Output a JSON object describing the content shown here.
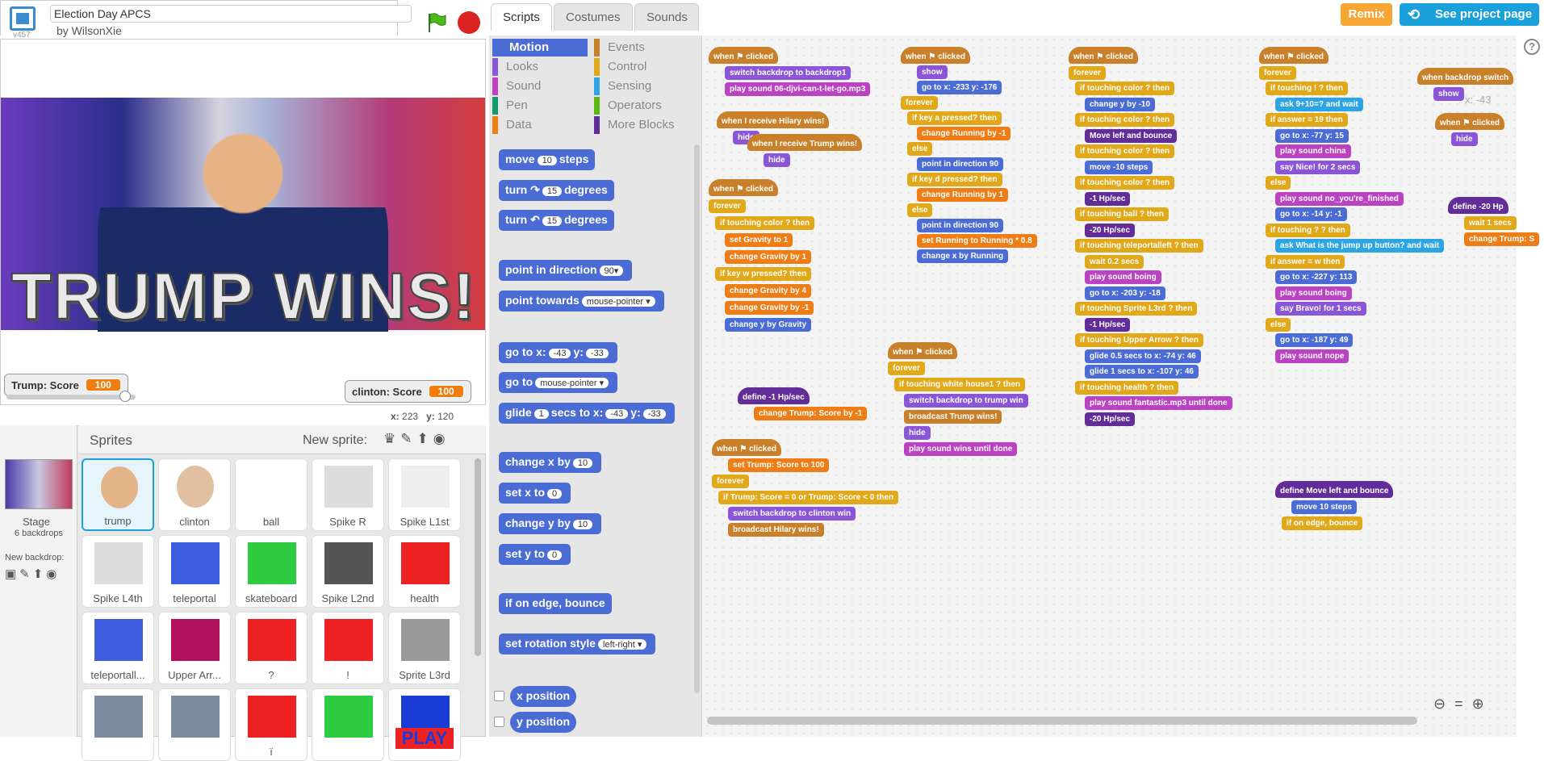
{
  "project": {
    "title": "Election Day APCS",
    "author": "by WilsonXie",
    "version": "v457"
  },
  "stage": {
    "banner_text": "TRUMP WINS!",
    "monitors": [
      {
        "label": "Trump: Score",
        "value": "100"
      },
      {
        "label": "clinton: Score",
        "value": "100"
      }
    ],
    "mouse_x_label": "x:",
    "mouse_x": "223",
    "mouse_y_label": "y:",
    "mouse_y": "120"
  },
  "sprites_panel": {
    "title": "Sprites",
    "new_sprite_label": "New sprite:",
    "stage_label": "Stage",
    "stage_backdrops": "6 backdrops",
    "new_backdrop_label": "New backdrop:",
    "sprites": [
      {
        "name": "trump",
        "selected": true
      },
      {
        "name": "clinton"
      },
      {
        "name": "ball"
      },
      {
        "name": "Spike R"
      },
      {
        "name": "Spike L1st"
      },
      {
        "name": "Spike L4th"
      },
      {
        "name": "teleportal"
      },
      {
        "name": "skateboard"
      },
      {
        "name": "Spike L2nd"
      },
      {
        "name": "health"
      },
      {
        "name": "teleportall..."
      },
      {
        "name": "Upper Arr..."
      },
      {
        "name": "?"
      },
      {
        "name": "!"
      },
      {
        "name": "Sprite L3rd"
      },
      {
        "name": ""
      },
      {
        "name": ""
      },
      {
        "name": "ï"
      },
      {
        "name": ""
      },
      {
        "name": "PLAY"
      }
    ]
  },
  "tabs": [
    "Scripts",
    "Costumes",
    "Sounds"
  ],
  "header_buttons": {
    "remix": "Remix",
    "see_project": "See project page"
  },
  "categories": [
    {
      "name": "Motion",
      "color": "#4a6cd4",
      "active": true
    },
    {
      "name": "Events",
      "color": "#c8802a"
    },
    {
      "name": "Looks",
      "color": "#8a55d7"
    },
    {
      "name": "Control",
      "color": "#e1a91a"
    },
    {
      "name": "Sound",
      "color": "#bb42c3"
    },
    {
      "name": "Sensing",
      "color": "#2ca5e2"
    },
    {
      "name": "Pen",
      "color": "#0e9a6c"
    },
    {
      "name": "Operators",
      "color": "#5cb712"
    },
    {
      "name": "Data",
      "color": "#ee7d16"
    },
    {
      "name": "More Blocks",
      "color": "#632d99"
    }
  ],
  "palette_blocks": [
    {
      "text": "move",
      "arg": "10",
      "suffix": "steps"
    },
    {
      "text": "turn ↷",
      "arg": "15",
      "suffix": "degrees"
    },
    {
      "text": "turn ↶",
      "arg": "15",
      "suffix": "degrees"
    },
    {
      "text": "point in direction",
      "arg": "90▾",
      "suffix": ""
    },
    {
      "text": "point towards",
      "arg": "mouse-pointer ▾",
      "suffix": ""
    },
    {
      "text": "go to x:",
      "arg": "-43",
      "suffix": "y:",
      "arg2": "-33"
    },
    {
      "text": "go to",
      "arg": "mouse-pointer ▾",
      "suffix": ""
    },
    {
      "text": "glide",
      "arg": "1",
      "suffix": "secs to x:",
      "arg2": "-43",
      "suffix2": "y:",
      "arg3": "-33"
    },
    {
      "text": "change x by",
      "arg": "10",
      "suffix": ""
    },
    {
      "text": "set x to",
      "arg": "0",
      "suffix": ""
    },
    {
      "text": "change y by",
      "arg": "10",
      "suffix": ""
    },
    {
      "text": "set y to",
      "arg": "0",
      "suffix": ""
    },
    {
      "text": "if on edge, bounce",
      "arg": "",
      "suffix": ""
    },
    {
      "text": "set rotation style",
      "arg": "left-right ▾",
      "suffix": ""
    },
    {
      "text": "x position",
      "arg": "",
      "suffix": ""
    },
    {
      "text": "y position",
      "arg": "",
      "suffix": ""
    }
  ],
  "scripts": {
    "s1": [
      "when ⚑ clicked",
      "switch backdrop to backdrop1",
      "play sound 06-djvi-can-t-let-go.mp3"
    ],
    "s2": [
      "when I receive Hilary wins!",
      "hide"
    ],
    "s3": [
      "when I receive Trump wins!",
      "hide"
    ],
    "s4": [
      "when ⚑ clicked",
      "forever",
      "if touching color ? then",
      "set Gravity to 1",
      "change Gravity by 1",
      "if key w pressed? then",
      "change Gravity by 4",
      "change Gravity by -1",
      "change y by Gravity"
    ],
    "s5": [
      "define -1 Hp/sec",
      "change Trump: Score by -1"
    ],
    "s6": [
      "when ⚑ clicked",
      "set Trump: Score to 100",
      "forever",
      "if Trump: Score = 0 or Trump: Score < 0 then",
      "switch backdrop to clinton win",
      "broadcast Hilary wins!"
    ],
    "s7": [
      "when ⚑ clicked",
      "show",
      "go to x: -233 y: -176",
      "forever",
      "if key a pressed? then",
      "change Running by -1",
      "else",
      "point in direction 90",
      "if key d pressed? then",
      "change Running by 1",
      "else",
      "point in direction 90",
      "set Running to Running * 0.8",
      "change x by Running"
    ],
    "s8": [
      "when ⚑ clicked",
      "forever",
      "if touching white house1 ? then",
      "switch backdrop to trump win",
      "broadcast Trump wins!",
      "hide",
      "play sound wins until done"
    ],
    "s9": [
      "when ⚑ clicked",
      "forever",
      "if touching color ? then",
      "change y by -10",
      "if touching color ? then",
      "Move left and bounce",
      "if touching color ? then",
      "move -10 steps",
      "if touching color ? then",
      "-1 Hp/sec",
      "if touching ball ? then",
      "-20 Hp/sec",
      "if touching teleportalleft ? then",
      "wait 0.2 secs",
      "play sound boing",
      "go to x: -203 y: -18",
      "if touching Sprite L3rd ? then",
      "-1 Hp/sec",
      "if touching Upper Arrow ? then",
      "glide 0.5 secs to x: -74 y: 46",
      "glide 1 secs to x: -107 y: 46",
      "if touching health ? then",
      "play sound fantastic.mp3 until done",
      "-20 Hp/sec"
    ],
    "s10": [
      "when ⚑ clicked",
      "forever",
      "if touching ! ? then",
      "ask 9+10=? and wait",
      "if answer = 19 then",
      "go to x: -77 y: 15",
      "play sound china",
      "say Nice! for 2 secs",
      "else",
      "play sound no_you're_finished",
      "go to x: -14 y: -1",
      "if touching ? ? then",
      "ask What is the jump up button? and wait",
      "if answer = w then",
      "go to x: -227 y: 113",
      "play sound boing",
      "say Bravo! for 1 secs",
      "else",
      "go to x: -187 y: 49",
      "play sound nope"
    ],
    "s11": [
      "define Move left and bounce",
      "move 10 steps",
      "if on edge, bounce"
    ],
    "s12": [
      "when backdrop switch",
      "show"
    ],
    "s13": [
      "when ⚑ clicked",
      "hide"
    ],
    "s14": [
      "define -20 Hp",
      "wait 1 secs",
      "change Trump: S"
    ]
  },
  "ghost_xy": "x: -43",
  "colors": {
    "accent": "#1aa0db",
    "remix": "#f7a533",
    "monitor": "#f27d0f"
  }
}
